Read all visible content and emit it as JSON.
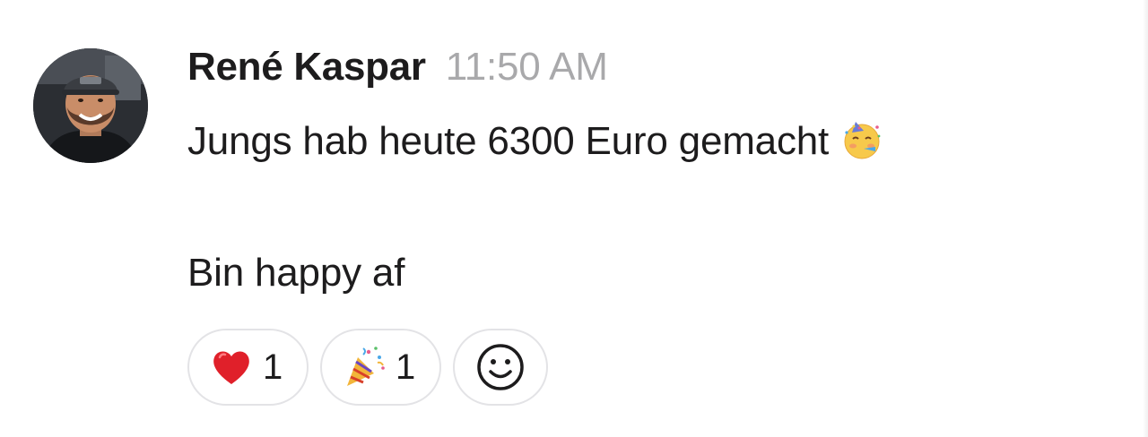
{
  "message": {
    "author": "René Kaspar",
    "timestamp": "11:50 AM",
    "lines": [
      "Jungs hab heute 6300 Euro gemacht",
      "Bin happy af"
    ],
    "inline_emoji": "partying-face-emoji"
  },
  "reactions": [
    {
      "emoji": "heart-emoji",
      "count": "1"
    },
    {
      "emoji": "party-popper-emoji",
      "count": "1"
    }
  ],
  "add_reaction": {
    "icon": "smiley-add-reaction-icon"
  },
  "colors": {
    "text": "#1d1c1d",
    "muted": "#a9a9ab",
    "pill_border": "#e3e3e6"
  }
}
